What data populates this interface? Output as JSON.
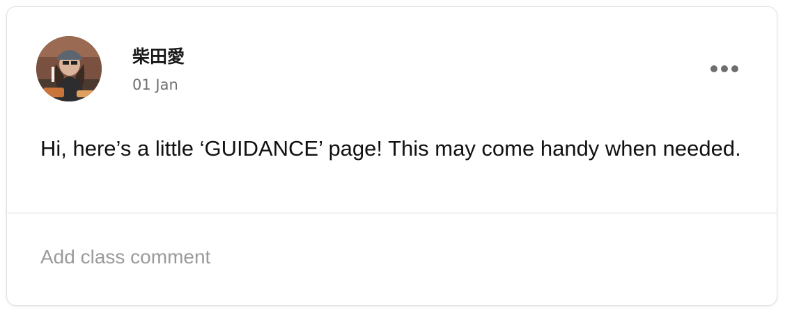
{
  "post": {
    "author_name": "柴田愛",
    "date": "01 Jan",
    "body": "Hi, here’s a little ‘GUIDANCE’ page! This may come handy when needed.",
    "more_icon": "more-horizontal-icon"
  },
  "comment": {
    "placeholder": "Add class comment"
  },
  "colors": {
    "card_border": "#e3e3e3",
    "text_primary": "#111111",
    "text_secondary": "#6f6f6f",
    "placeholder": "#9a9a9a",
    "icon": "#6e6e6e"
  }
}
